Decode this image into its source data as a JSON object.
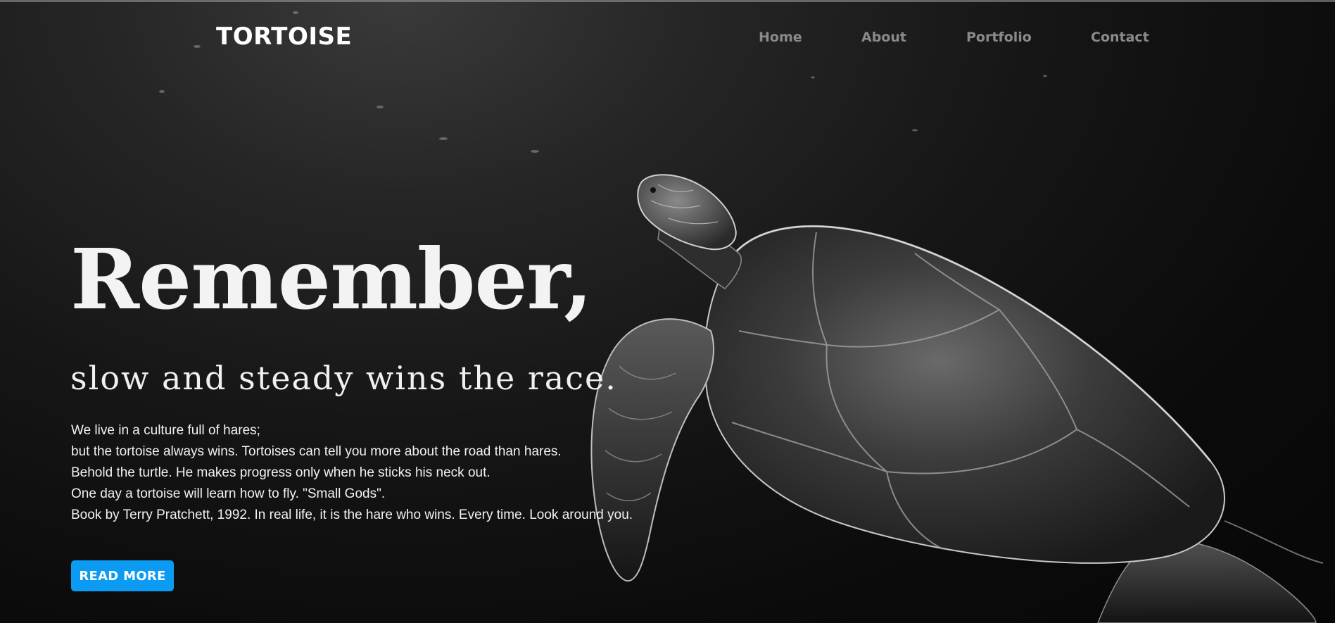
{
  "brand": {
    "logo_text": "TORTOISE"
  },
  "nav": {
    "items": [
      {
        "label": "Home"
      },
      {
        "label": "About"
      },
      {
        "label": "Portfolio"
      },
      {
        "label": "Contact"
      }
    ]
  },
  "hero": {
    "headline": "Remember,",
    "subheadline": "slow and steady wins the race.",
    "paragraph_lines": [
      "We live in a culture full of hares;",
      "but the tortoise always wins. Tortoises can tell you more about the road than hares.",
      "Behold the turtle. He makes progress only when he sticks his neck out.",
      "One day a tortoise will learn how to fly. \"Small Gods\".",
      "Book by Terry Pratchett, 1992. In real life, it is the hare who wins. Every time. Look around you."
    ],
    "cta_label": "READ MORE",
    "background_image": "black-and-white-sea-turtle-swimming-icon"
  },
  "colors": {
    "background": "#0b0b0b",
    "logo": "#ffffff",
    "nav_text": "#8a8a8a",
    "headline": "#f3f3f3",
    "cta_background": "#0b9bf2",
    "cta_text": "#ffffff"
  }
}
